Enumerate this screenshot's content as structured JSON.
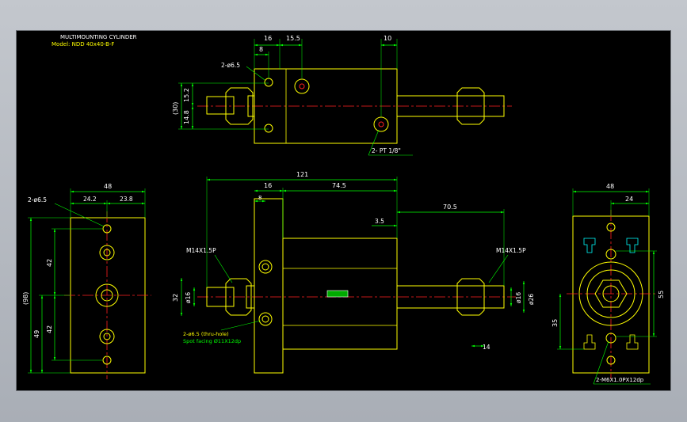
{
  "title": {
    "line1": "MULTIMOUNTING CYLINDER",
    "line2": "Model: NDD 40x40-B-F"
  },
  "colors": {
    "background": "#000000",
    "outline": "#ffff00",
    "dimension": "#00ff00",
    "centerline": "#ff2020",
    "detail": "#00ffff",
    "text_white": "#ffffff"
  },
  "top_view": {
    "dim_16": "16",
    "dim_15_5": "15.5",
    "dim_10": "10",
    "dim_8": "8",
    "hole_label": "2-ø6.5",
    "port_label": "2- PT 1/8\"",
    "dim_30": "(30)",
    "dim_15_2": "15.2",
    "dim_14_8": "14.8"
  },
  "front_view": {
    "dim_121": "121",
    "dim_16": "16",
    "dim_74_5": "74.5",
    "dim_8": "8",
    "dim_70_5": "70.5",
    "dim_3_5": "3.5",
    "thread_left": "M14X1.5P",
    "thread_right": "M14X1.5P",
    "dim_32": "32",
    "dim_d16_left": "ø16",
    "dim_d16_right": "ø16",
    "dim_d26": "ø26",
    "dim_14": "14",
    "hole_note": "2-ø6.5 (thru-hole)",
    "spot_note": "Spot facing Ø11X12dp"
  },
  "left_view": {
    "hole_label": "2-ø6.5",
    "dim_48": "48",
    "dim_24_2": "24.2",
    "dim_23_8": "23.8",
    "dim_98": "(98)",
    "dim_42a": "42",
    "dim_42b": "42",
    "dim_49": "49"
  },
  "right_view": {
    "dim_48": "48",
    "dim_24": "24",
    "dim_55": "55",
    "dim_35": "35",
    "tap_label": "2-M6X1.0PX12dp"
  }
}
